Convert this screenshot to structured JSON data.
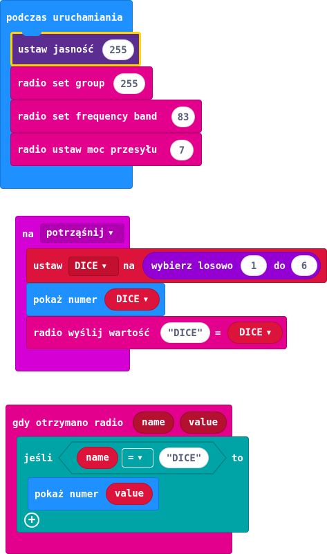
{
  "colors": {
    "basic": "#1e90ff",
    "basic_dark": "#1877d5",
    "led": "#5c2d91",
    "radio": "#e3008c",
    "radio_dark": "#b50070",
    "input": "#d400d4",
    "variables": "#dc143c",
    "variables_dark": "#b4102f",
    "math": "#9400d3",
    "logic": "#00a4a6",
    "logic_dark": "#008284",
    "selection": "#ffd400"
  },
  "on_start": {
    "header": "podczas uruchamiania",
    "set_brightness": {
      "label": "ustaw jasność",
      "value": "255"
    },
    "set_group": {
      "label": "radio set group",
      "value": "255"
    },
    "set_frequency": {
      "label": "radio set frequency band",
      "value": "83"
    },
    "set_power": {
      "label": "radio ustaw moc przesyłu",
      "value": "7"
    }
  },
  "on_shake": {
    "prefix": "na",
    "gesture": "potrząśnij",
    "set_var": {
      "label": "ustaw",
      "variable": "DICE",
      "to_label": "na",
      "random_label": "wybierz losowo",
      "min": "1",
      "max_label": "do",
      "max": "6"
    },
    "show_number": {
      "label": "pokaż numer",
      "variable": "DICE"
    },
    "send_value": {
      "label": "radio wyślij wartość",
      "name": "\"DICE\"",
      "equals": "=",
      "variable": "DICE"
    }
  },
  "on_receive": {
    "header": "gdy otrzymano radio",
    "param_name": "name",
    "param_value": "value",
    "if_block": {
      "if_label": "jeśli",
      "left": "name",
      "operator": "=",
      "right": "\"DICE\"",
      "then_label": "to",
      "show_number": {
        "label": "pokaż numer",
        "variable": "value"
      },
      "add_icon": "plus-icon"
    }
  }
}
